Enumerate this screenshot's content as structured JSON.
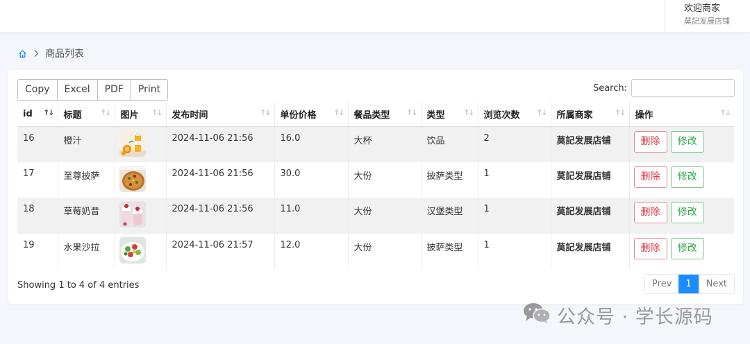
{
  "header": {
    "welcome": "欢迎商家",
    "shop_name": "莫記发展店铺"
  },
  "breadcrumb": {
    "icons": [
      "home-icon",
      "chevron-right-icon"
    ],
    "current": "商品列表"
  },
  "toolbar": {
    "buttons": [
      "Copy",
      "Excel",
      "PDF",
      "Print"
    ],
    "search_label": "Search:",
    "search_value": ""
  },
  "table": {
    "columns": [
      "id",
      "标题",
      "图片",
      "发布时间",
      "单份价格",
      "餐品类型",
      "类型",
      "浏览次数",
      "所属商家",
      "操作"
    ],
    "sorted_column": "id",
    "rows": [
      {
        "id": "16",
        "title": "橙汁",
        "image": "orange-juice-photo",
        "time": "2024-11-06 21:56",
        "price": "16.0",
        "portion": "大杯",
        "category": "饮品",
        "views": "2",
        "merchant": "莫記发展店铺"
      },
      {
        "id": "17",
        "title": "至尊披萨",
        "image": "pizza-photo",
        "time": "2024-11-06 21:56",
        "price": "30.0",
        "portion": "大份",
        "category": "披萨类型",
        "views": "1",
        "merchant": "莫記发展店铺"
      },
      {
        "id": "18",
        "title": "草莓奶昔",
        "image": "strawberry-milkshake-photo",
        "time": "2024-11-06 21:56",
        "price": "11.0",
        "portion": "大份",
        "category": "汉堡类型",
        "views": "1",
        "merchant": "莫記发展店铺"
      },
      {
        "id": "19",
        "title": "水果沙拉",
        "image": "fruit-salad-photo",
        "time": "2024-11-06 21:57",
        "price": "12.0",
        "portion": "大份",
        "category": "披萨类型",
        "views": "1",
        "merchant": "莫記发展店铺"
      }
    ],
    "delete_label": "删除",
    "edit_label": "修改"
  },
  "footer": {
    "info": "Showing 1 to 4 of 4 entries",
    "prev": "Prev",
    "current_page": "1",
    "next": "Next"
  },
  "watermark": {
    "text": "公众号 · 学长源码",
    "icon": "wechat-icon"
  },
  "colors": {
    "delete": "#dc3545",
    "edit": "#28a745",
    "active_page": "#1a8cff",
    "home_icon": "#1a8cff"
  }
}
